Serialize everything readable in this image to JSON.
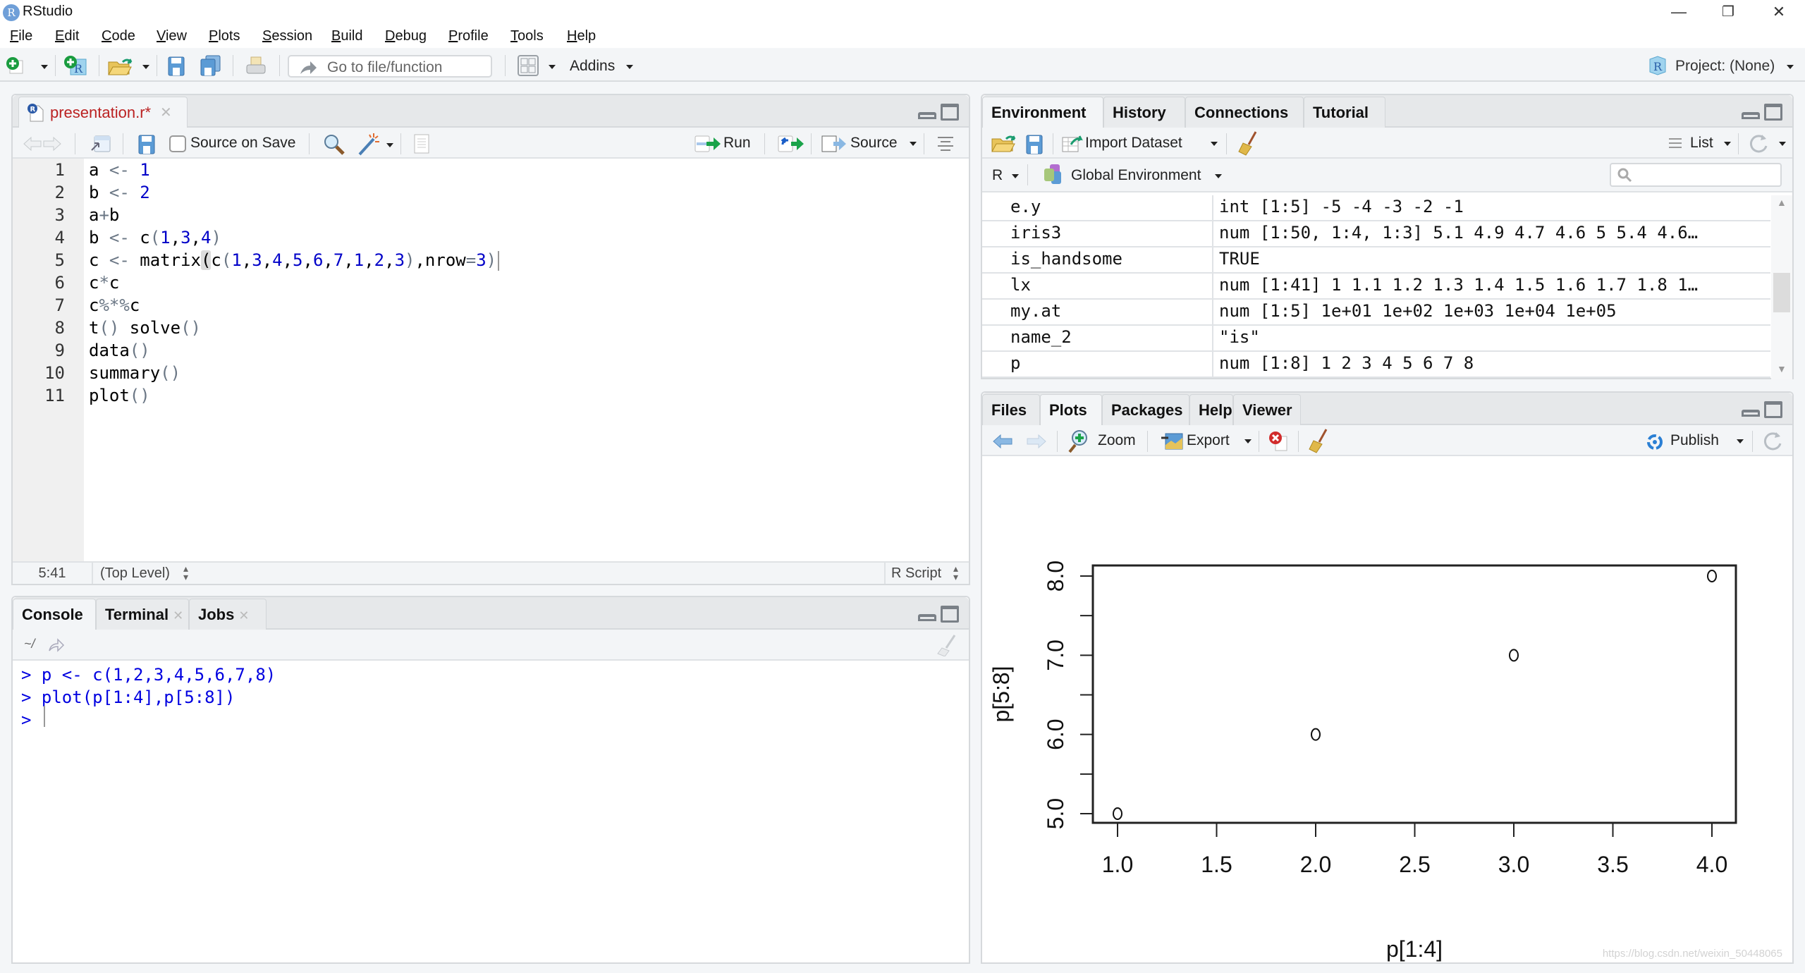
{
  "window": {
    "title": "RStudio",
    "app_icon": "R",
    "controls": {
      "minimize": "—",
      "restore": "❐",
      "close": "✕"
    }
  },
  "menu": [
    "File",
    "Edit",
    "Code",
    "View",
    "Plots",
    "Session",
    "Build",
    "Debug",
    "Profile",
    "Tools",
    "Help"
  ],
  "main_toolbar": {
    "goto_placeholder": "Go to file/function",
    "addins_label": "Addins",
    "project_label": "Project: (None)"
  },
  "editor": {
    "tab_label": "presentation.r*",
    "toolbar": {
      "source_on_save": "Source on Save",
      "source_on_save_checked": false,
      "run_label": "Run",
      "source_label": "Source"
    },
    "lines": [
      {
        "n": "1",
        "tokens": [
          [
            "",
            "a "
          ],
          [
            "op",
            "<-"
          ],
          [
            "",
            " "
          ],
          [
            "num",
            "1"
          ]
        ]
      },
      {
        "n": "2",
        "tokens": [
          [
            "",
            "b "
          ],
          [
            "op",
            "<-"
          ],
          [
            "",
            " "
          ],
          [
            "num",
            "2"
          ]
        ]
      },
      {
        "n": "3",
        "tokens": [
          [
            "",
            "a"
          ],
          [
            "op",
            "+"
          ],
          [
            "",
            "b"
          ]
        ]
      },
      {
        "n": "4",
        "tokens": [
          [
            "",
            "b "
          ],
          [
            "op",
            "<-"
          ],
          [
            "",
            " c"
          ],
          [
            "par",
            "("
          ],
          [
            "num",
            "1"
          ],
          [
            "",
            ","
          ],
          [
            "num",
            "3"
          ],
          [
            "",
            ","
          ],
          [
            "num",
            "4"
          ],
          [
            "par",
            ")"
          ]
        ]
      },
      {
        "n": "5",
        "tokens": [
          [
            "",
            "c "
          ],
          [
            "op",
            "<-"
          ],
          [
            "",
            " matrix"
          ],
          [
            "hl",
            "("
          ],
          [
            "",
            "c"
          ],
          [
            "par",
            "("
          ],
          [
            "num",
            "1"
          ],
          [
            "",
            ","
          ],
          [
            "num",
            "3"
          ],
          [
            "",
            ","
          ],
          [
            "num",
            "4"
          ],
          [
            "",
            ","
          ],
          [
            "num",
            "5"
          ],
          [
            "",
            ","
          ],
          [
            "num",
            "6"
          ],
          [
            "",
            ","
          ],
          [
            "num",
            "7"
          ],
          [
            "",
            ","
          ],
          [
            "num",
            "1"
          ],
          [
            "",
            ","
          ],
          [
            "num",
            "2"
          ],
          [
            "",
            ","
          ],
          [
            "num",
            "3"
          ],
          [
            "par",
            ")"
          ],
          [
            "",
            ",nrow"
          ],
          [
            "op",
            "="
          ],
          [
            "num",
            "3"
          ],
          [
            "par",
            ")"
          ]
        ]
      },
      {
        "n": "6",
        "tokens": [
          [
            "",
            "c"
          ],
          [
            "op",
            "*"
          ],
          [
            "",
            "c"
          ]
        ]
      },
      {
        "n": "7",
        "tokens": [
          [
            "",
            "c"
          ],
          [
            "op",
            "%*%"
          ],
          [
            "",
            "c"
          ]
        ]
      },
      {
        "n": "8",
        "tokens": [
          [
            "",
            "t"
          ],
          [
            "par",
            "()"
          ],
          [
            "",
            " solve"
          ],
          [
            "par",
            "()"
          ]
        ]
      },
      {
        "n": "9",
        "tokens": [
          [
            "",
            "data"
          ],
          [
            "par",
            "()"
          ]
        ]
      },
      {
        "n": "10",
        "tokens": [
          [
            "",
            "summary"
          ],
          [
            "par",
            "()"
          ]
        ]
      },
      {
        "n": "11",
        "tokens": [
          [
            "",
            "plot"
          ],
          [
            "par",
            "()"
          ]
        ]
      }
    ],
    "status": {
      "position": "5:41",
      "scope": "(Top Level)",
      "file_type": "R Script"
    }
  },
  "console": {
    "tabs": [
      {
        "label": "Console",
        "closable": false,
        "active": true
      },
      {
        "label": "Terminal",
        "closable": true,
        "active": false
      },
      {
        "label": "Jobs",
        "closable": true,
        "active": false
      }
    ],
    "path": "~/",
    "lines": [
      "> p <- c(1,2,3,4,5,6,7,8)",
      "> plot(p[1:4],p[5:8])",
      "> "
    ]
  },
  "environment": {
    "tabs": [
      {
        "label": "Environment",
        "active": true
      },
      {
        "label": "History",
        "active": false
      },
      {
        "label": "Connections",
        "active": false
      },
      {
        "label": "Tutorial",
        "active": false
      }
    ],
    "toolbar": {
      "import_label": "Import Dataset",
      "view_label": "List",
      "lang_label": "R",
      "scope_label": "Global Environment",
      "search_placeholder": ""
    },
    "rows": [
      {
        "name": "e.y",
        "value": "int [1:5] -5 -4 -3 -2 -1"
      },
      {
        "name": "iris3",
        "value": "num [1:50, 1:4, 1:3] 5.1 4.9 4.7 4.6 5 5.4 4.6…"
      },
      {
        "name": "is_handsome",
        "value": "TRUE"
      },
      {
        "name": "lx",
        "value": "num [1:41] 1 1.1 1.2 1.3 1.4 1.5 1.6 1.7 1.8 1…"
      },
      {
        "name": "my.at",
        "value": "num [1:5] 1e+01 1e+02 1e+03 1e+04 1e+05"
      },
      {
        "name": "name_2",
        "value": "\"is\""
      },
      {
        "name": "p",
        "value": "num [1:8] 1 2 3 4 5 6 7 8"
      }
    ]
  },
  "files_pane": {
    "tabs": [
      {
        "label": "Files",
        "active": false
      },
      {
        "label": "Plots",
        "active": true
      },
      {
        "label": "Packages",
        "active": false
      },
      {
        "label": "Help",
        "active": false
      },
      {
        "label": "Viewer",
        "active": false
      }
    ],
    "toolbar": {
      "zoom_label": "Zoom",
      "export_label": "Export",
      "publish_label": "Publish"
    }
  },
  "chart_data": {
    "type": "scatter",
    "title": "",
    "xlabel": "p[1:4]",
    "ylabel": "p[5:8]",
    "x": [
      1,
      2,
      3,
      4
    ],
    "y": [
      5,
      6,
      7,
      8
    ],
    "xlim": [
      1,
      4
    ],
    "ylim": [
      5,
      8
    ],
    "xticks": [
      1.0,
      1.5,
      2.0,
      2.5,
      3.0,
      3.5,
      4.0
    ],
    "xtick_labels": [
      "1.0",
      "1.5",
      "2.0",
      "2.5",
      "3.0",
      "3.5",
      "4.0"
    ],
    "yticks": [
      5.0,
      5.5,
      6.0,
      6.5,
      7.0,
      7.5,
      8.0
    ],
    "ytick_labels": [
      "5.0",
      "",
      "6.0",
      "",
      "7.0",
      "",
      "8.0"
    ],
    "marker": "open-circle",
    "grid": false,
    "legend": "none"
  },
  "watermark": "https://blog.csdn.net/weixin_50448065"
}
